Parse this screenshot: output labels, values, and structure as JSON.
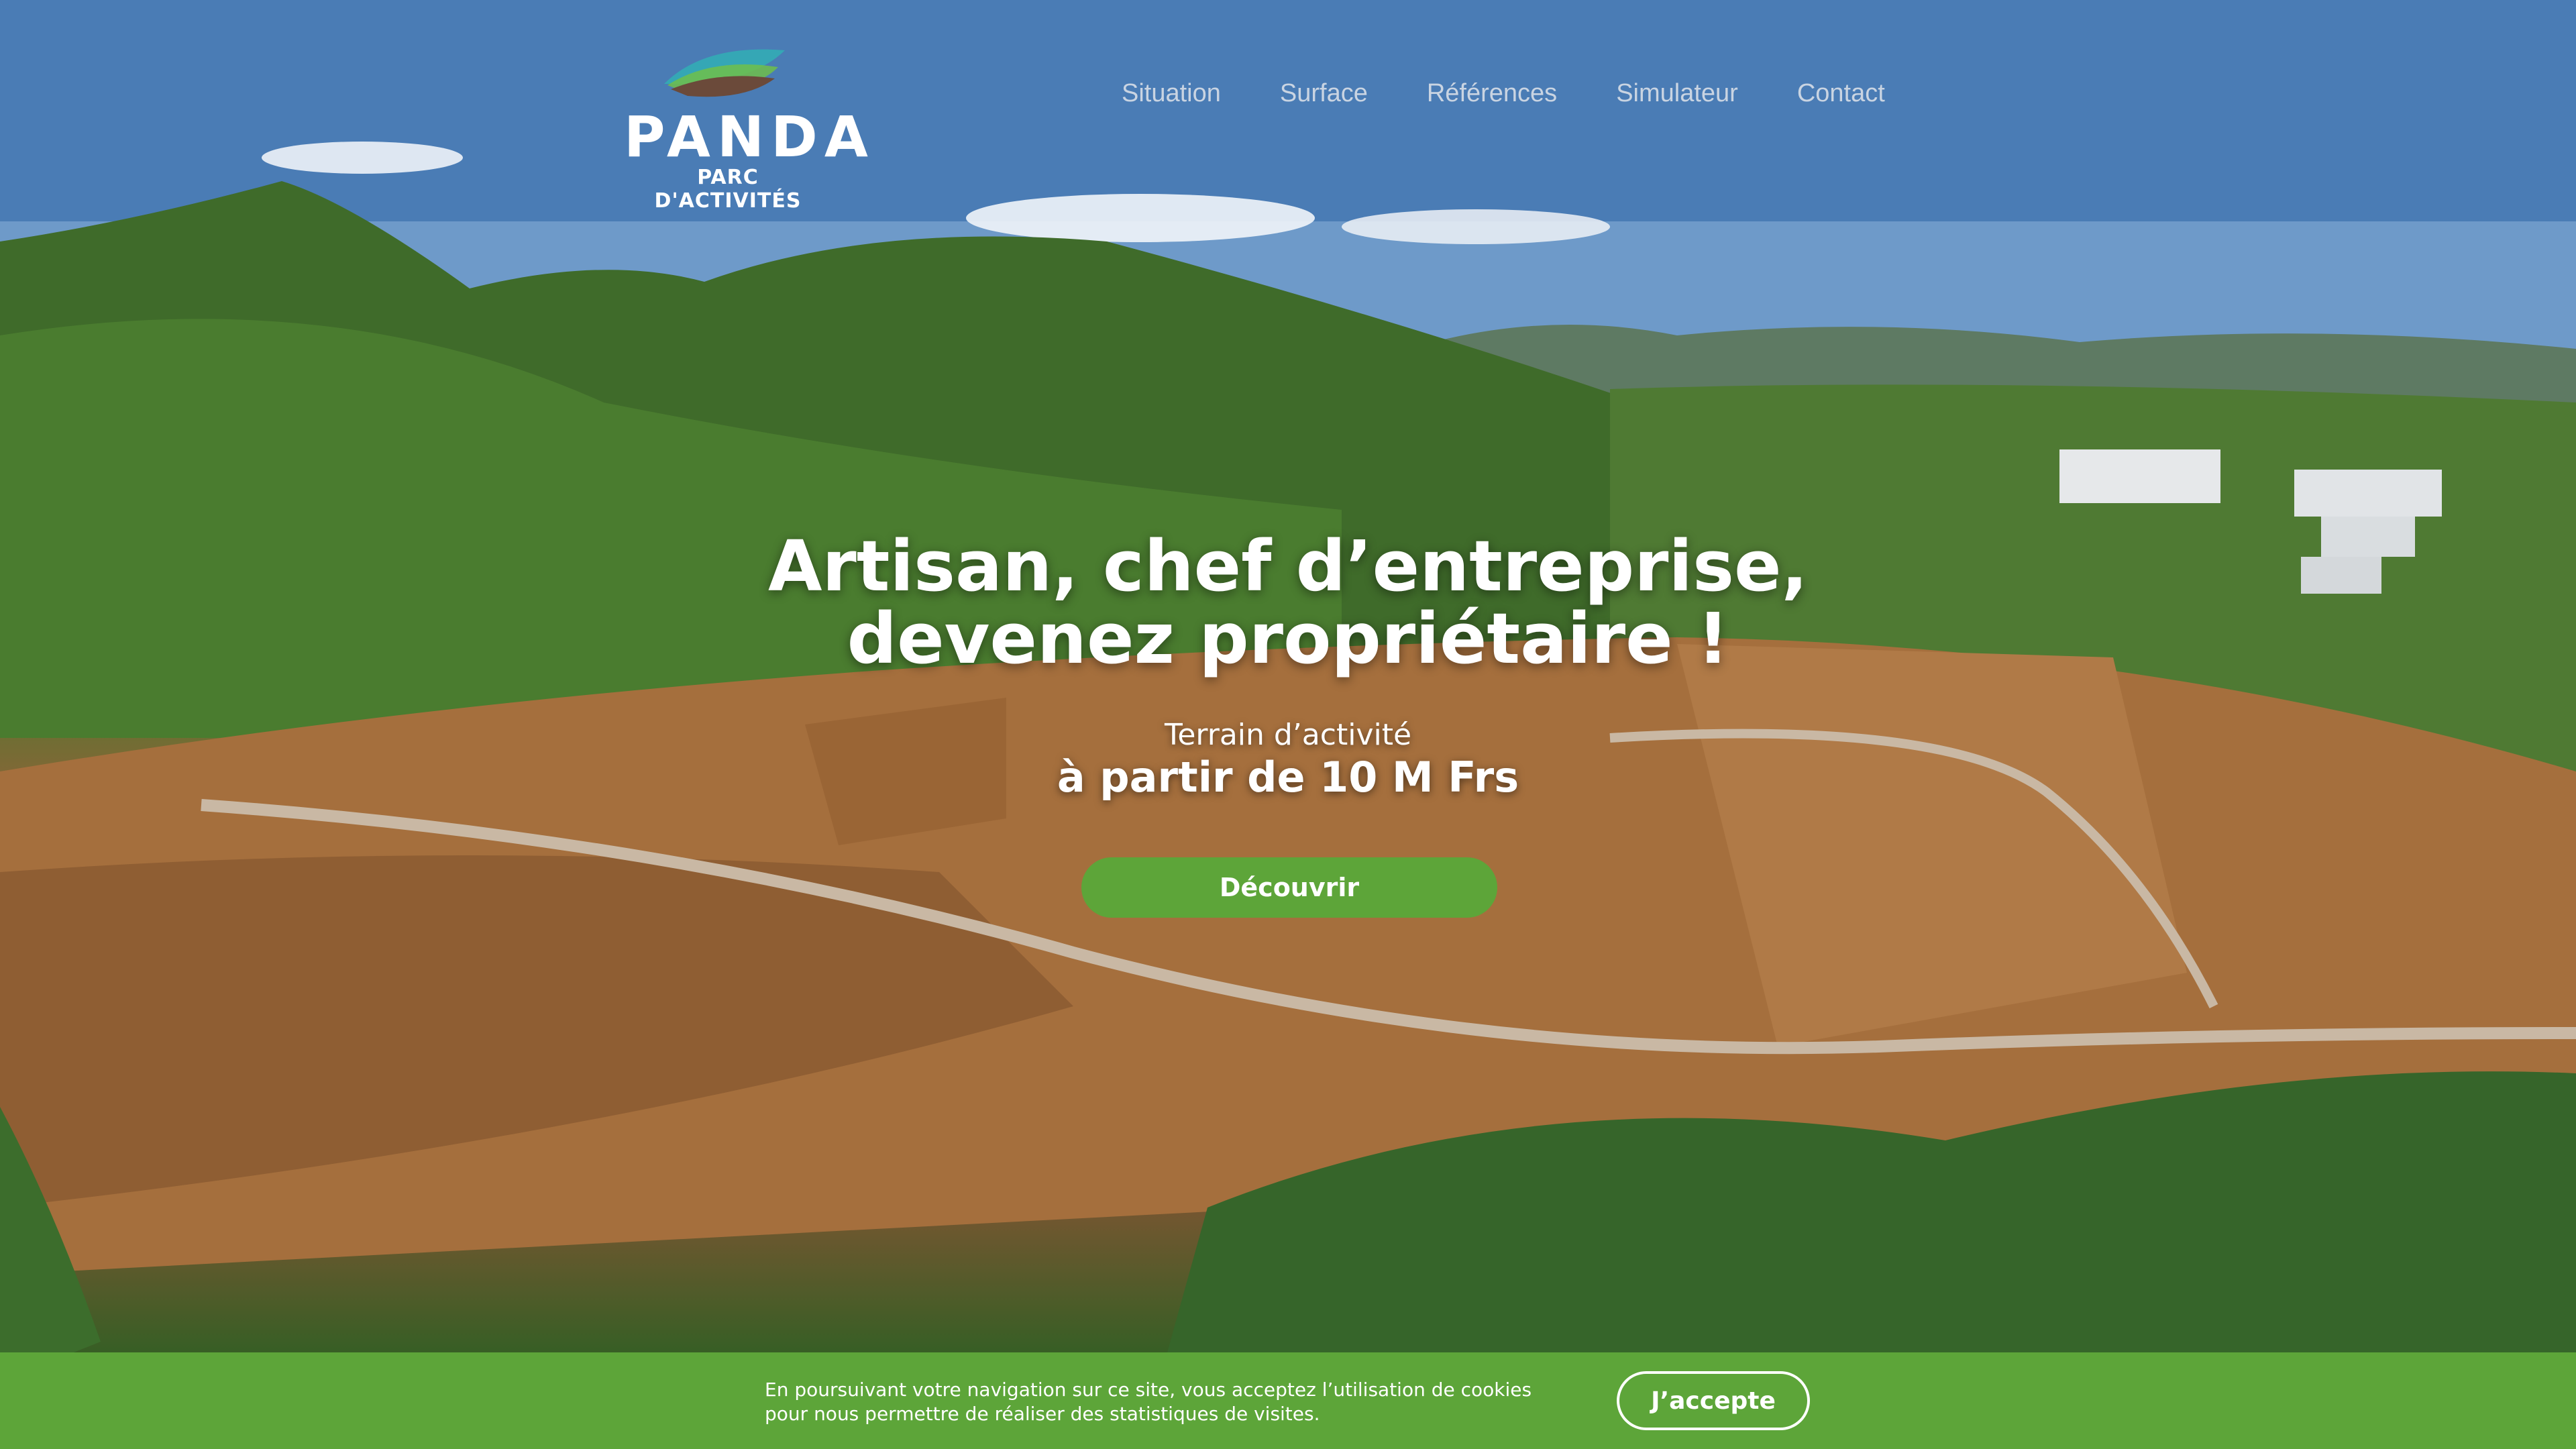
{
  "brand": {
    "name": "PANDA",
    "tagline": "PARC D'ACTIVITÉS",
    "colors": {
      "accent": "#5da539",
      "logo_teal": "#35a7b5",
      "logo_brown": "#6b4a3a"
    }
  },
  "nav": {
    "items": [
      {
        "label": "Situation"
      },
      {
        "label": "Surface"
      },
      {
        "label": "Références"
      },
      {
        "label": "Simulateur"
      },
      {
        "label": "Contact"
      }
    ]
  },
  "hero": {
    "headline_line1": "Artisan, chef d’entreprise,",
    "headline_line2": "devenez propriétaire !",
    "sub_line1": "Terrain d’activité",
    "sub_line2": "à partir de 10 M Frs",
    "cta_label": "Découvrir",
    "background": "aerial-photo-industrial-park"
  },
  "cookie_banner": {
    "text_line1": "En poursuivant votre navigation sur ce site, vous acceptez l’utilisation de cookies",
    "text_line2": "pour nous permettre de réaliser des statistiques de visites.",
    "accept_label": "J’accepte"
  }
}
